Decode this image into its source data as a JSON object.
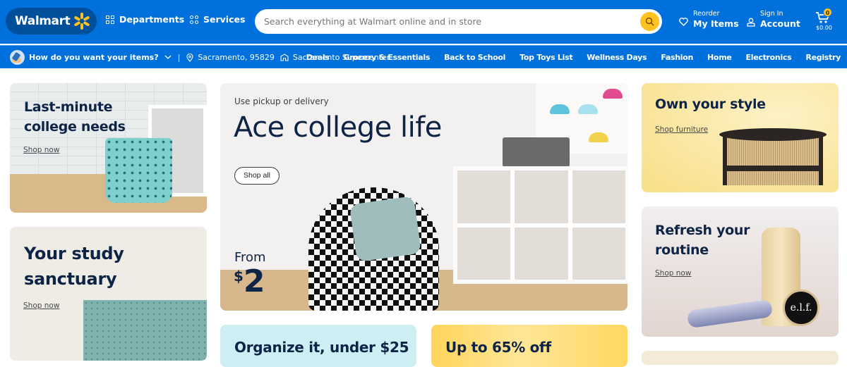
{
  "header": {
    "logo_text": "Walmart",
    "departments_label": "Departments",
    "services_label": "Services",
    "search": {
      "placeholder": "Search everything at Walmart online and in store",
      "value": ""
    },
    "reorder": {
      "small": "Reorder",
      "big": "My Items"
    },
    "account": {
      "small": "Sign In",
      "big": "Account"
    },
    "cart": {
      "count": "0",
      "total": "$0.00"
    },
    "colors": {
      "brand_blue": "#0071dc",
      "logo_pill": "#004f9a",
      "spark_yellow": "#ffc220"
    }
  },
  "subnav": {
    "fulfillment_prompt": "How do you want your items?",
    "separator": "|",
    "location": "Sacramento, 95829",
    "store": "Sacramento Supercenter",
    "links": [
      "Deals",
      "Grocery & Essentials",
      "Back to School",
      "Top Toys List",
      "Wellness Days",
      "Fashion",
      "Home",
      "Electronics",
      "Registry"
    ]
  },
  "cards": {
    "college_needs": {
      "title_line1": "Last-minute",
      "title_line2": "college needs",
      "link": "Shop now"
    },
    "study": {
      "title_line1": "Your study",
      "title_line2": "sanctuary",
      "link": "Shop now"
    },
    "hero": {
      "kicker": "Use pickup or delivery",
      "title": "Ace college life",
      "button": "Shop all",
      "from": "From",
      "currency": "$",
      "price": "2"
    },
    "organize": {
      "title": "Organize it, under $25"
    },
    "discount": {
      "title": "Up to 65% off"
    },
    "style": {
      "title": "Own your style",
      "link": "Shop furniture"
    },
    "routine": {
      "title_line1": "Refresh your",
      "title_line2": "routine",
      "link": "Shop now",
      "product_label": "e.l.f."
    }
  }
}
